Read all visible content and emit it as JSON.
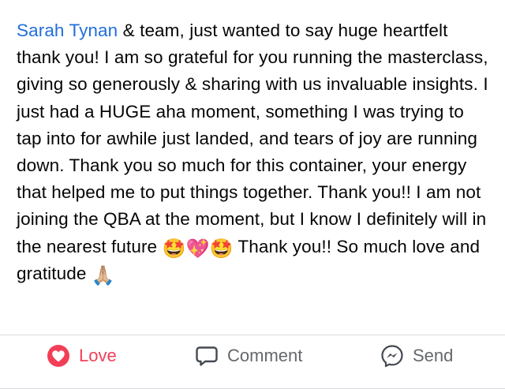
{
  "post": {
    "mention": "Sarah Tynan",
    "text_part1": " & team, just wanted to say huge heartfelt  thank you! I am so grateful for you running the masterclass, giving so generously & sharing with us invaluable insights. I just had a HUGE aha moment, something I was trying to tap into for awhile just landed, and tears of joy are running down. Thank you so much for this container, your energy that helped me to put things together. Thank you!! I am not joining the QBA at the moment, but I know I definitely will in the nearest future ",
    "emoji1": "🤩",
    "emoji2": "💖",
    "emoji3": "🤩",
    "text_part2": " Thank you!! So much love and gratitude ",
    "emoji4": "🙏🏼"
  },
  "actions": {
    "love_label": "Love",
    "comment_label": "Comment",
    "send_label": "Send"
  },
  "colors": {
    "mention": "#216fdb",
    "love": "#f33e58",
    "action_text": "#65676b",
    "divider": "#d9dadd"
  },
  "icons": {
    "love": "heart-icon",
    "comment": "comment-bubble-icon",
    "send": "messenger-icon"
  }
}
